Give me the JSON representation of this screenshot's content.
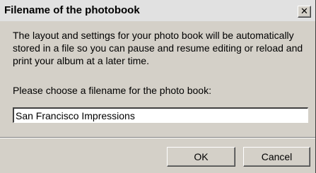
{
  "window": {
    "title": "Filename of the photobook",
    "close_glyph": "✕"
  },
  "content": {
    "description": "The layout and settings for your photo book will be automatically stored in a file so you can pause and resume editing or reload and print your album at a later time.",
    "prompt": "Please choose a filename for the photo book:",
    "filename_value": "San Francisco Impressions"
  },
  "buttons": {
    "ok_label": "OK",
    "cancel_label": "Cancel"
  }
}
